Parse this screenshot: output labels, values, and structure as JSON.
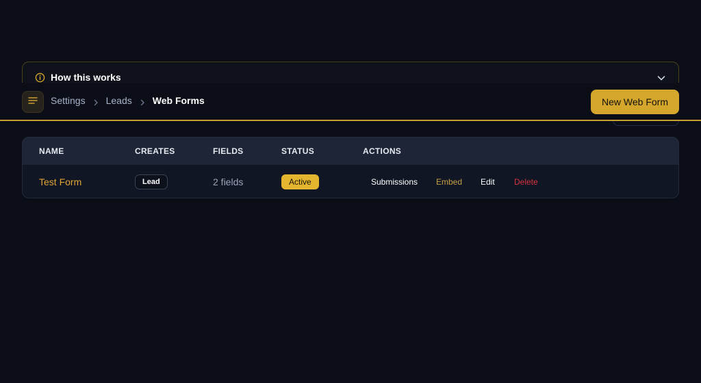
{
  "how_it_works": {
    "title": "How this works"
  },
  "header": {
    "breadcrumb": [
      "Settings",
      "Leads",
      "Web Forms"
    ],
    "new_button_label": "New Web Form"
  },
  "table": {
    "columns": [
      "NAME",
      "CREATES",
      "FIELDS",
      "STATUS",
      "ACTIONS"
    ],
    "rows": [
      {
        "name": "Test Form",
        "creates": "Lead",
        "fields": "2 fields",
        "status": "Active",
        "actions": [
          "Submissions",
          "Embed",
          "Edit",
          "Delete"
        ]
      }
    ]
  },
  "colors": {
    "accent": "#d4a72c",
    "delete": "#d8323f",
    "background": "#0b0e17"
  },
  "icons": {
    "info": "info-icon",
    "menu": "menu-icon",
    "chevron": "chevron-down-icon",
    "separator": "chevron-right-icon"
  }
}
